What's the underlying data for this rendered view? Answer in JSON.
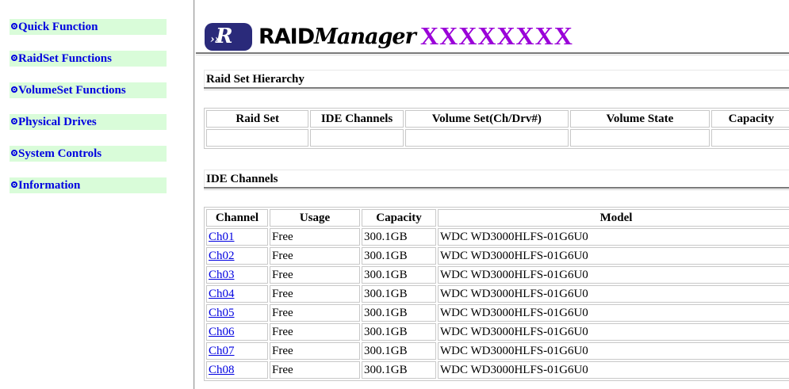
{
  "nav": {
    "items": [
      {
        "label": "Quick Function"
      },
      {
        "label": "RaidSet Functions"
      },
      {
        "label": "VolumeSet Functions"
      },
      {
        "label": "Physical Drives"
      },
      {
        "label": "System Controls"
      },
      {
        "label": "Information"
      }
    ]
  },
  "header": {
    "logo_badge": "R",
    "logo_badge_small": "››",
    "logo_raid": "RAID",
    "logo_manager": "Manager",
    "title": "XXXXXXXX"
  },
  "raid_set_hierarchy": {
    "title": "Raid Set Hierarchy",
    "columns": [
      "Raid Set",
      "IDE Channels",
      "Volume Set(Ch/Drv#)",
      "Volume State",
      "Capacity"
    ],
    "rows": [
      [
        "",
        "",
        "",
        "",
        ""
      ]
    ]
  },
  "ide_channels": {
    "title": "IDE Channels",
    "columns": [
      "Channel",
      "Usage",
      "Capacity",
      "Model"
    ],
    "rows": [
      {
        "channel": "Ch01",
        "usage": "Free",
        "capacity": "300.1GB",
        "model": "WDC WD3000HLFS-01G6U0"
      },
      {
        "channel": "Ch02",
        "usage": "Free",
        "capacity": "300.1GB",
        "model": "WDC WD3000HLFS-01G6U0"
      },
      {
        "channel": "Ch03",
        "usage": "Free",
        "capacity": "300.1GB",
        "model": "WDC WD3000HLFS-01G6U0"
      },
      {
        "channel": "Ch04",
        "usage": "Free",
        "capacity": "300.1GB",
        "model": "WDC WD3000HLFS-01G6U0"
      },
      {
        "channel": "Ch05",
        "usage": "Free",
        "capacity": "300.1GB",
        "model": "WDC WD3000HLFS-01G6U0"
      },
      {
        "channel": "Ch06",
        "usage": "Free",
        "capacity": "300.1GB",
        "model": "WDC WD3000HLFS-01G6U0"
      },
      {
        "channel": "Ch07",
        "usage": "Free",
        "capacity": "300.1GB",
        "model": "WDC WD3000HLFS-01G6U0"
      },
      {
        "channel": "Ch08",
        "usage": "Free",
        "capacity": "300.1GB",
        "model": "WDC WD3000HLFS-01G6U0"
      }
    ]
  },
  "colors": {
    "nav_bg": "#d9fcd9",
    "link": "#0000e0",
    "title_accent": "#9a00d8",
    "logo_badge": "#2a2a7a"
  }
}
